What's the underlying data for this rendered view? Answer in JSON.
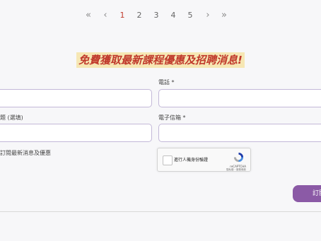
{
  "pagination": {
    "first": "«",
    "prev": "‹",
    "pages": [
      "1",
      "2",
      "3",
      "4",
      "5"
    ],
    "next": "›",
    "last": "»"
  },
  "headline": "免費獲取最新課程優惠及招聘消息!",
  "form": {
    "phone_label": "電話 *",
    "topic_label": "題 (選填)",
    "email_label": "電子信箱 *",
    "subscribe_label": "訂閱最新消息及優惠",
    "captcha": {
      "text": "進行人機身份驗證",
      "brand": "reCAPTCHA",
      "terms": "隱私權・服務條款"
    },
    "submit_label": "訂閱"
  }
}
